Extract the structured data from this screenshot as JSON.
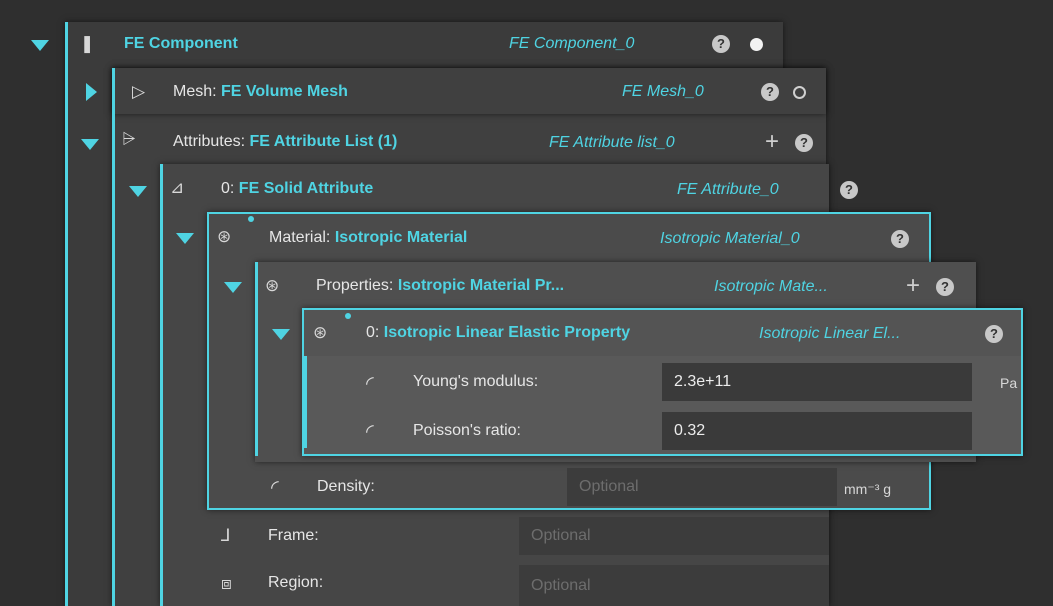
{
  "component": {
    "label": "FE Component",
    "instance": "FE Component_0",
    "help": "?"
  },
  "mesh": {
    "key": "Mesh:",
    "value": "FE Volume Mesh",
    "instance": "FE Mesh_0",
    "help": "?"
  },
  "attributes": {
    "key": "Attributes:",
    "value": "FE Attribute List (1)",
    "instance": "FE Attribute list_0",
    "add": "+",
    "help": "?"
  },
  "attribute0": {
    "key": "0:",
    "value": "FE Solid Attribute",
    "instance": "FE Attribute_0",
    "help": "?"
  },
  "material": {
    "key": "Material:",
    "value": "Isotropic Material",
    "instance": "Isotropic Material_0",
    "help": "?"
  },
  "properties": {
    "key": "Properties:",
    "value": "Isotropic Material Pr...",
    "instance": "Isotropic Mate...",
    "add": "+",
    "help": "?"
  },
  "property0": {
    "key": "0:",
    "value": "Isotropic Linear Elastic Property",
    "instance": "Isotropic Linear El...",
    "help": "?"
  },
  "youngs": {
    "label": "Young's modulus:",
    "value": "2.3e+11",
    "unit": "Pa"
  },
  "poisson": {
    "label": "Poisson's ratio:",
    "value": "0.32"
  },
  "density": {
    "label": "Density:",
    "placeholder": "Optional",
    "unit": "mm⁻³ g"
  },
  "frame": {
    "label": "Frame:",
    "placeholder": "Optional"
  },
  "region": {
    "label": "Region:",
    "placeholder": "Optional"
  },
  "colors": {
    "accent": "#4fd4e3",
    "background": "#2f2f2f"
  },
  "icons": [
    "component-icon",
    "mesh-icon",
    "attribute-list-icon",
    "solid-attribute-icon",
    "material-icon",
    "properties-icon",
    "property-icon",
    "signal-icon",
    "frame-icon",
    "region-icon"
  ]
}
